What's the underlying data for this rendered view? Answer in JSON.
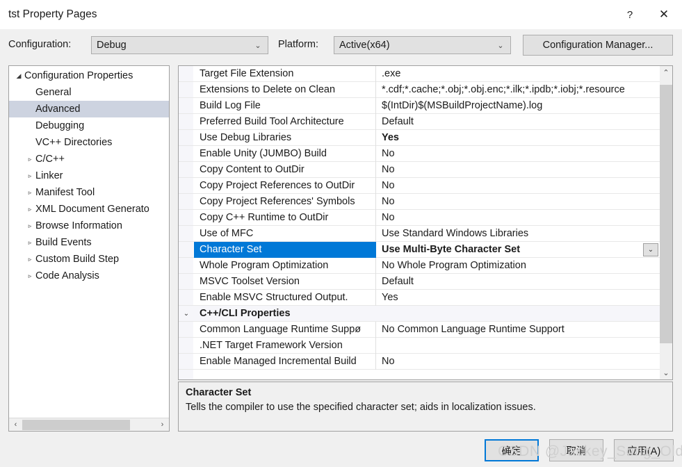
{
  "window": {
    "title": "tst Property Pages",
    "help_button": "?",
    "close_button": "✕"
  },
  "configbar": {
    "configuration_label": "Configuration:",
    "configuration_value": "Debug",
    "platform_label": "Platform:",
    "platform_value": "Active(x64)",
    "configuration_manager_button": "Configuration Manager...",
    "combo_arrow": "⌄"
  },
  "tree": {
    "items": [
      {
        "label": "Configuration Properties",
        "indent": 0,
        "expander": "◢",
        "selected": false
      },
      {
        "label": "General",
        "indent": 1,
        "expander": "",
        "selected": false
      },
      {
        "label": "Advanced",
        "indent": 1,
        "expander": "",
        "selected": true
      },
      {
        "label": "Debugging",
        "indent": 1,
        "expander": "",
        "selected": false
      },
      {
        "label": "VC++ Directories",
        "indent": 1,
        "expander": "",
        "selected": false
      },
      {
        "label": "C/C++",
        "indent": 1,
        "expander": "▹",
        "selected": false
      },
      {
        "label": "Linker",
        "indent": 1,
        "expander": "▹",
        "selected": false
      },
      {
        "label": "Manifest Tool",
        "indent": 1,
        "expander": "▹",
        "selected": false
      },
      {
        "label": "XML Document Generato",
        "indent": 1,
        "expander": "▹",
        "selected": false
      },
      {
        "label": "Browse Information",
        "indent": 1,
        "expander": "▹",
        "selected": false
      },
      {
        "label": "Build Events",
        "indent": 1,
        "expander": "▹",
        "selected": false
      },
      {
        "label": "Custom Build Step",
        "indent": 1,
        "expander": "▹",
        "selected": false
      },
      {
        "label": "Code Analysis",
        "indent": 1,
        "expander": "▹",
        "selected": false
      }
    ],
    "hscroll_left_arrow": "‹",
    "hscroll_right_arrow": "›"
  },
  "grid": {
    "rows": [
      {
        "name": "Target File Extension",
        "value": ".exe",
        "bold": false,
        "group": false,
        "selected": false,
        "chevron": "",
        "dropdown": false
      },
      {
        "name": "Extensions to Delete on Clean",
        "value": "*.cdf;*.cache;*.obj;*.obj.enc;*.ilk;*.ipdb;*.iobj;*.resource",
        "bold": false,
        "group": false,
        "selected": false,
        "chevron": "",
        "dropdown": false
      },
      {
        "name": "Build Log File",
        "value": "$(IntDir)$(MSBuildProjectName).log",
        "bold": false,
        "group": false,
        "selected": false,
        "chevron": "",
        "dropdown": false
      },
      {
        "name": "Preferred Build Tool Architecture",
        "value": "Default",
        "bold": false,
        "group": false,
        "selected": false,
        "chevron": "",
        "dropdown": false
      },
      {
        "name": "Use Debug Libraries",
        "value": "Yes",
        "bold": true,
        "group": false,
        "selected": false,
        "chevron": "",
        "dropdown": false
      },
      {
        "name": "Enable Unity (JUMBO) Build",
        "value": "No",
        "bold": false,
        "group": false,
        "selected": false,
        "chevron": "",
        "dropdown": false
      },
      {
        "name": "Copy Content to OutDir",
        "value": "No",
        "bold": false,
        "group": false,
        "selected": false,
        "chevron": "",
        "dropdown": false
      },
      {
        "name": "Copy Project References to OutDir",
        "value": "No",
        "bold": false,
        "group": false,
        "selected": false,
        "chevron": "",
        "dropdown": false
      },
      {
        "name": "Copy Project References' Symbols",
        "value": "No",
        "bold": false,
        "group": false,
        "selected": false,
        "chevron": "",
        "dropdown": false
      },
      {
        "name": "Copy C++ Runtime to OutDir",
        "value": "No",
        "bold": false,
        "group": false,
        "selected": false,
        "chevron": "",
        "dropdown": false
      },
      {
        "name": "Use of MFC",
        "value": "Use Standard Windows Libraries",
        "bold": false,
        "group": false,
        "selected": false,
        "chevron": "",
        "dropdown": false
      },
      {
        "name": "Character Set",
        "value": "Use Multi-Byte Character Set",
        "bold": true,
        "group": false,
        "selected": true,
        "chevron": "",
        "dropdown": true
      },
      {
        "name": "Whole Program Optimization",
        "value": "No Whole Program Optimization",
        "bold": false,
        "group": false,
        "selected": false,
        "chevron": "",
        "dropdown": false
      },
      {
        "name": "MSVC Toolset Version",
        "value": "Default",
        "bold": false,
        "group": false,
        "selected": false,
        "chevron": "",
        "dropdown": false
      },
      {
        "name": "Enable MSVC Structured Output.",
        "value": "Yes",
        "bold": false,
        "group": false,
        "selected": false,
        "chevron": "",
        "dropdown": false
      },
      {
        "name": "C++/CLI Properties",
        "value": "",
        "bold": false,
        "group": true,
        "selected": false,
        "chevron": "⌄",
        "dropdown": false
      },
      {
        "name": "Common Language Runtime Suppø",
        "value": "No Common Language Runtime Support",
        "bold": false,
        "group": false,
        "selected": false,
        "chevron": "",
        "dropdown": false
      },
      {
        "name": ".NET Target Framework Version",
        "value": "",
        "bold": false,
        "group": false,
        "selected": false,
        "chevron": "",
        "dropdown": false
      },
      {
        "name": "Enable Managed Incremental Build",
        "value": "No",
        "bold": false,
        "group": false,
        "selected": false,
        "chevron": "",
        "dropdown": false
      }
    ],
    "dropdown_arrow": "⌄",
    "vscroll_up_arrow": "⌃",
    "vscroll_down_arrow": "⌄"
  },
  "description": {
    "title": "Character Set",
    "text": "Tells the compiler to use the specified character set; aids in localization issues."
  },
  "footer": {
    "ok_button": "确定",
    "cancel_button": "取消",
    "apply_button": "应用(A)"
  },
  "watermark": {
    "text": "CSDN @Jackey_Song_Old"
  },
  "colors": {
    "selection_blue": "#0078d7",
    "tree_selection": "#cdd3e0",
    "dialog_bg": "#f0f0f0"
  }
}
